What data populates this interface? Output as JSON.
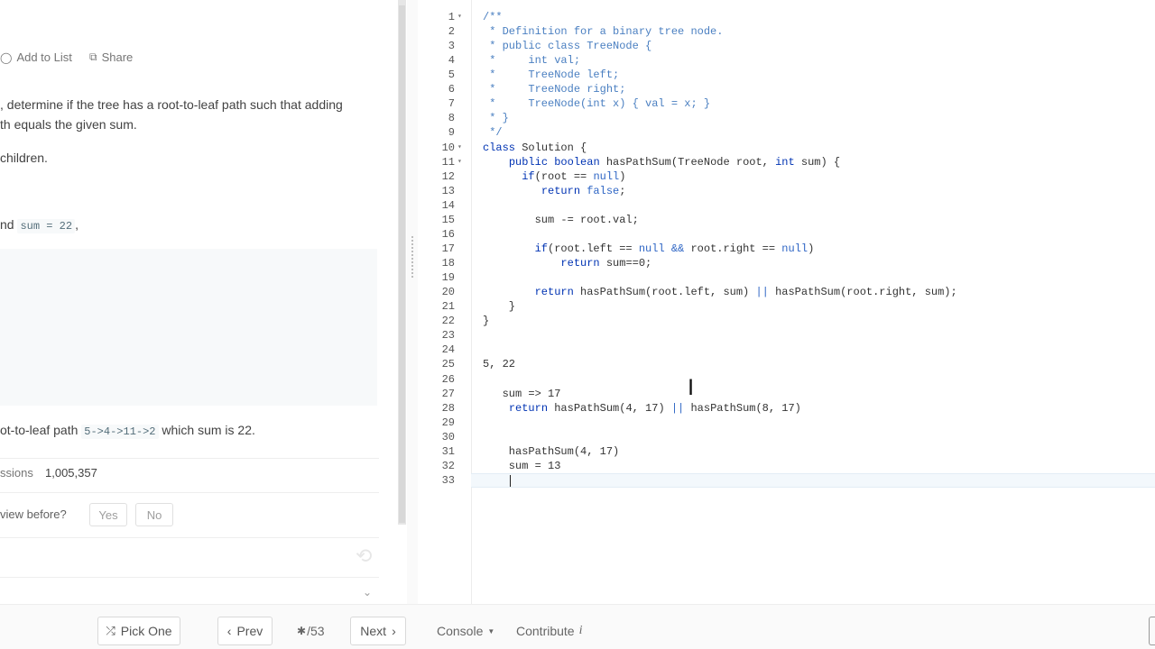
{
  "problem": {
    "actions": [
      {
        "label": "Add to List",
        "icon": "circle-plus-icon"
      },
      {
        "label": "Share",
        "icon": "share-icon"
      }
    ],
    "desc_line1": ", determine if the tree has a root-to-leaf path such that adding",
    "desc_line2": "th equals the given sum.",
    "note": " children.",
    "given_prefix": "nd",
    "given_code": "sum = 22",
    "given_suffix": ",",
    "explain_prefix": "ot-to-leaf path",
    "explain_code": "5->4->11->2",
    "explain_suffix": "which sum is 22.",
    "submissions_label": "ssions",
    "submissions_value": "1,005,357",
    "interview_question": "view before?",
    "yes_label": "Yes",
    "no_label": "No"
  },
  "editor": {
    "lines": [
      {
        "n": "1",
        "fold": true,
        "code": "/**"
      },
      {
        "n": "2",
        "code": " * Definition for a binary tree node."
      },
      {
        "n": "3",
        "code": " * public class TreeNode {"
      },
      {
        "n": "4",
        "code": " *     int val;"
      },
      {
        "n": "5",
        "code": " *     TreeNode left;"
      },
      {
        "n": "6",
        "code": " *     TreeNode right;"
      },
      {
        "n": "7",
        "code": " *     TreeNode(int x) { val = x; }"
      },
      {
        "n": "8",
        "code": " * }"
      },
      {
        "n": "9",
        "code": " */"
      },
      {
        "n": "10",
        "fold": true,
        "code": "class Solution {"
      },
      {
        "n": "11",
        "fold": true,
        "code": "    public boolean hasPathSum(TreeNode root, int sum) {"
      },
      {
        "n": "12",
        "code": "      if(root == null)"
      },
      {
        "n": "13",
        "code": "         return false;"
      },
      {
        "n": "14",
        "code": ""
      },
      {
        "n": "15",
        "code": "        sum -= root.val;"
      },
      {
        "n": "16",
        "code": ""
      },
      {
        "n": "17",
        "code": "        if(root.left == null && root.right == null)"
      },
      {
        "n": "18",
        "code": "            return sum==0;"
      },
      {
        "n": "19",
        "code": ""
      },
      {
        "n": "20",
        "code": "        return hasPathSum(root.left, sum) || hasPathSum(root.right, sum);"
      },
      {
        "n": "21",
        "code": "    }"
      },
      {
        "n": "22",
        "code": "}"
      },
      {
        "n": "23",
        "code": ""
      },
      {
        "n": "24",
        "code": ""
      },
      {
        "n": "25",
        "code": "5, 22"
      },
      {
        "n": "26",
        "code": ""
      },
      {
        "n": "27",
        "code": "   sum => 17"
      },
      {
        "n": "28",
        "code": "    return hasPathSum(4, 17) || hasPathSum(8, 17)"
      },
      {
        "n": "29",
        "code": ""
      },
      {
        "n": "30",
        "code": ""
      },
      {
        "n": "31",
        "code": "    hasPathSum(4, 17)"
      },
      {
        "n": "32",
        "code": "    sum = 13"
      },
      {
        "n": "33",
        "code": ""
      }
    ],
    "active_line": "33"
  },
  "bottombar": {
    "pick_one": "Pick One",
    "prev": "Prev",
    "progress": "/53",
    "next": "Next",
    "console": "Console",
    "contribute": "Contribute"
  }
}
